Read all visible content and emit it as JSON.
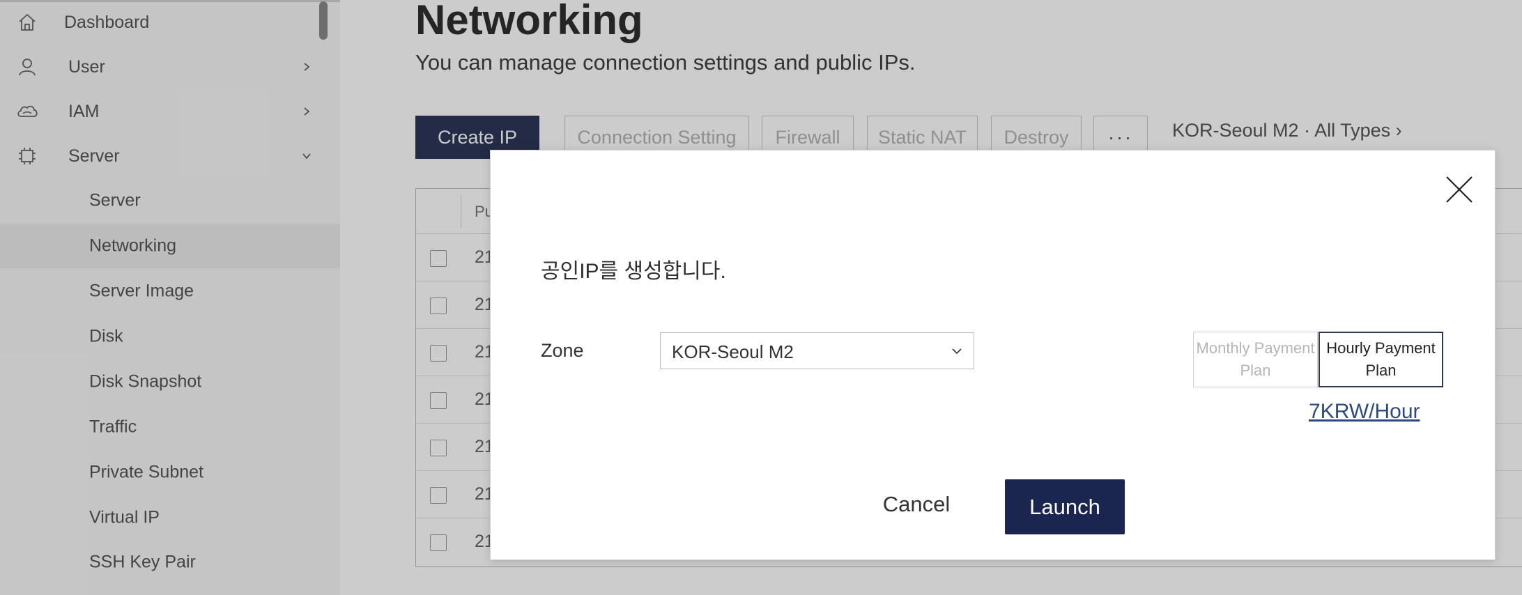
{
  "sidebar": {
    "items": [
      {
        "label": "Dashboard",
        "icon": "home-icon"
      },
      {
        "label": "User",
        "icon": "user-icon"
      },
      {
        "label": "IAM",
        "icon": "cloud-icon"
      },
      {
        "label": "Server",
        "icon": "chip-icon"
      }
    ],
    "sub_items": [
      {
        "label": "Server"
      },
      {
        "label": "Networking"
      },
      {
        "label": "Server Image"
      },
      {
        "label": "Disk"
      },
      {
        "label": "Disk Snapshot"
      },
      {
        "label": "Traffic"
      },
      {
        "label": "Private Subnet"
      },
      {
        "label": "Virtual IP"
      },
      {
        "label": "SSH Key Pair"
      }
    ]
  },
  "main": {
    "title": "Networking",
    "subtitle": "You can manage connection settings and public IPs.",
    "toolbar": {
      "create": "Create IP",
      "connection": "Connection Setting",
      "firewall": "Firewall",
      "static_nat": "Static NAT",
      "destroy": "Destroy",
      "more": "···"
    },
    "zone_filter": "KOR-Seoul M2 · All Types ›",
    "table": {
      "header": "Pu",
      "rows": [
        "21",
        "21",
        "21",
        "21",
        "21",
        "21",
        "21"
      ]
    }
  },
  "modal": {
    "message": "공인IP를 생성합니다.",
    "zone_label": "Zone",
    "zone_value": "KOR-Seoul M2",
    "plan_monthly": "Monthly Payment Plan",
    "plan_hourly": "Hourly Payment Plan",
    "price": "7KRW/Hour",
    "cancel": "Cancel",
    "launch": "Launch"
  },
  "colors": {
    "primary": "#2c3658",
    "launch": "#1a2550",
    "price_link": "#2e4a80"
  }
}
